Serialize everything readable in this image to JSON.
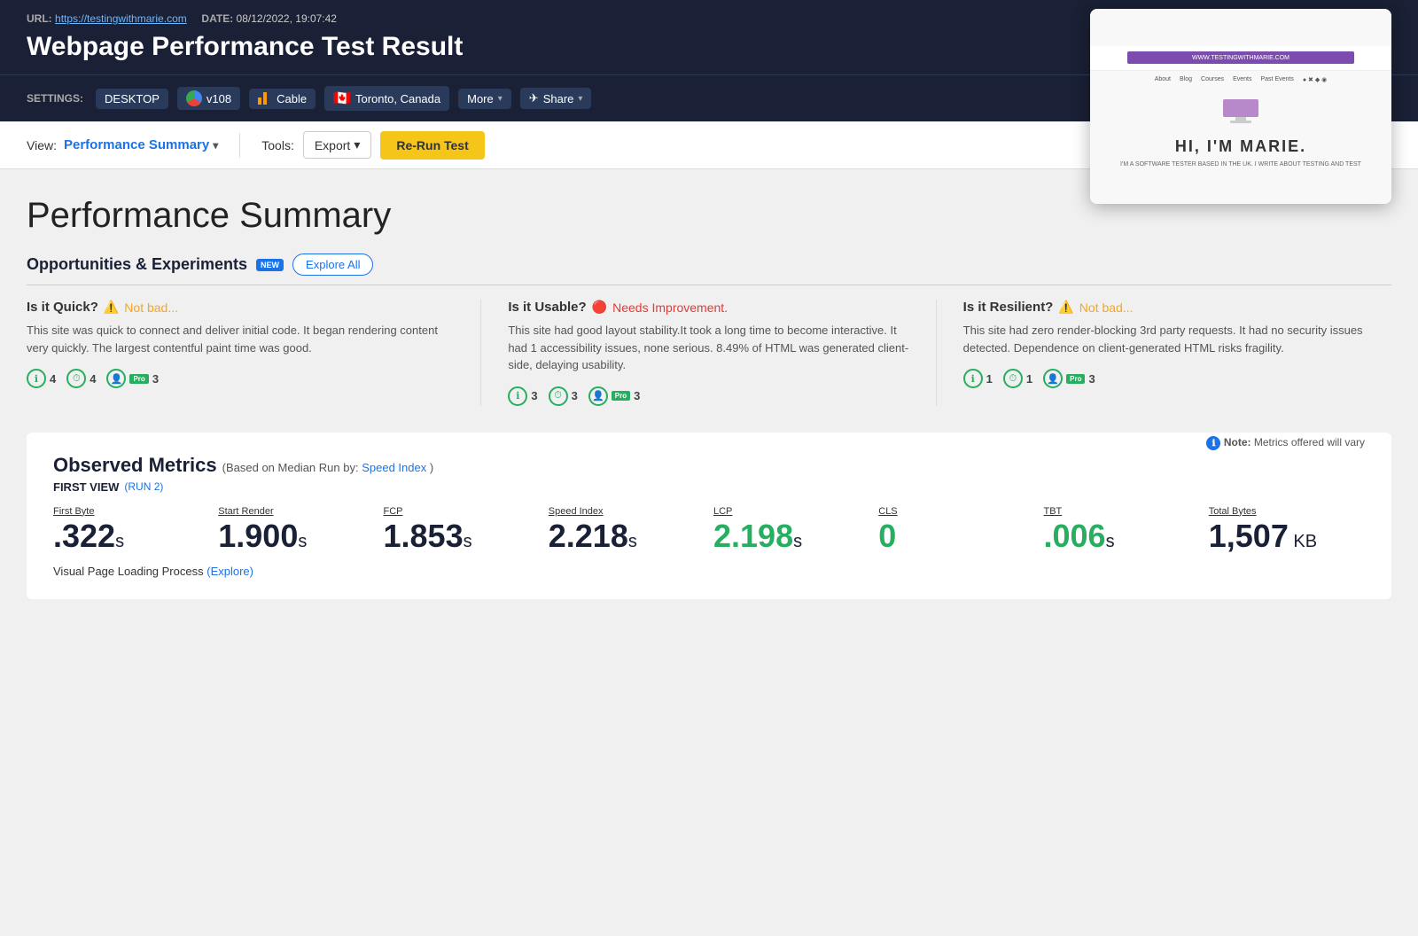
{
  "header": {
    "url_label": "URL:",
    "url": "https://testingwithmarie.com",
    "date_label": "DATE:",
    "date": "08/12/2022, 19:07:42",
    "title": "Webpage Performance Test Result",
    "settings_label": "SETTINGS:",
    "desktop": "DESKTOP",
    "browser_version": "v108",
    "connection": "Cable",
    "flag": "🇨🇦",
    "location": "Toronto, Canada",
    "more": "More",
    "share": "Share"
  },
  "toolbar": {
    "view_label": "View:",
    "view_selected": "Performance Summary",
    "tools_label": "Tools:",
    "export": "Export",
    "rerun": "Re-Run Test"
  },
  "performance_summary": {
    "title": "Performance Summary",
    "opportunities": {
      "title": "Opportunities & Experiments",
      "new_badge": "NEW",
      "explore_all": "Explore All"
    },
    "quick": {
      "title": "Is it Quick?",
      "icon": "⚠️",
      "status": "Not bad...",
      "body": "This site was quick to connect and deliver initial code. It began rendering content very quickly. The largest contentful paint time was good.",
      "metrics": [
        {
          "icon": "ℹ",
          "count": "4"
        },
        {
          "icon": "⏱",
          "count": "4"
        },
        {
          "pro": true,
          "count": "3"
        }
      ]
    },
    "usable": {
      "title": "Is it Usable?",
      "icon": "🔴",
      "status": "Needs Improvement.",
      "body": "This site had good layout stability.It took a long time to become interactive. It had 1 accessibility issues, none serious. 8.49% of HTML was generated client-side, delaying usability.",
      "metrics": [
        {
          "icon": "ℹ",
          "count": "3"
        },
        {
          "icon": "⏱",
          "count": "3"
        },
        {
          "pro": true,
          "count": "3"
        }
      ]
    },
    "resilient": {
      "title": "Is it Resilient?",
      "icon": "⚠️",
      "status": "Not bad...",
      "body": "This site had zero render-blocking 3rd party requests. It had no security issues detected. Dependence on client-generated HTML risks fragility.",
      "metrics": [
        {
          "icon": "ℹ",
          "count": "1"
        },
        {
          "icon": "⏱",
          "count": "1"
        },
        {
          "pro": true,
          "count": "3"
        }
      ]
    }
  },
  "observed_metrics": {
    "title": "Observed Metrics",
    "subtitle": "(Based on Median Run by:",
    "speed_index_link": "Speed Index",
    "subtitle_end": ")",
    "note_icon": "ℹ",
    "note": "Note:",
    "note_text": "Metrics offered will vary",
    "first_view_label": "FIRST VIEW",
    "run2_label": "(RUN 2)",
    "metrics": [
      {
        "label": "First Byte",
        "value": ".322",
        "unit": "s",
        "color": "default"
      },
      {
        "label": "Start Render",
        "value": "1.900",
        "unit": "s",
        "color": "default"
      },
      {
        "label": "FCP",
        "value": "1.853",
        "unit": "s",
        "color": "default"
      },
      {
        "label": "Speed Index",
        "value": "2.218",
        "unit": "s",
        "color": "default"
      },
      {
        "label": "LCP",
        "value": "2.198",
        "unit": "s",
        "color": "green"
      },
      {
        "label": "CLS",
        "value": "0",
        "unit": "",
        "color": "green"
      },
      {
        "label": "TBT",
        "value": ".006",
        "unit": "s",
        "color": "tbt-green"
      },
      {
        "label": "Total Bytes",
        "value": "1,507",
        "unit": "KB",
        "color": "default"
      }
    ],
    "visual_label": "Visual Page Loading Process",
    "explore_link": "(Explore)"
  },
  "screenshot": {
    "site_url": "WWW.TESTINGWITHMARIE.COM",
    "nav_items": [
      "About",
      "Blog",
      "Courses",
      "Events",
      "Past Events"
    ],
    "hero_text": "HI, I'M MARIE.",
    "sub_text": "I'M A SOFTWARE TESTER BASED IN THE UK. I WRITE ABOUT TESTING AND TEST"
  }
}
